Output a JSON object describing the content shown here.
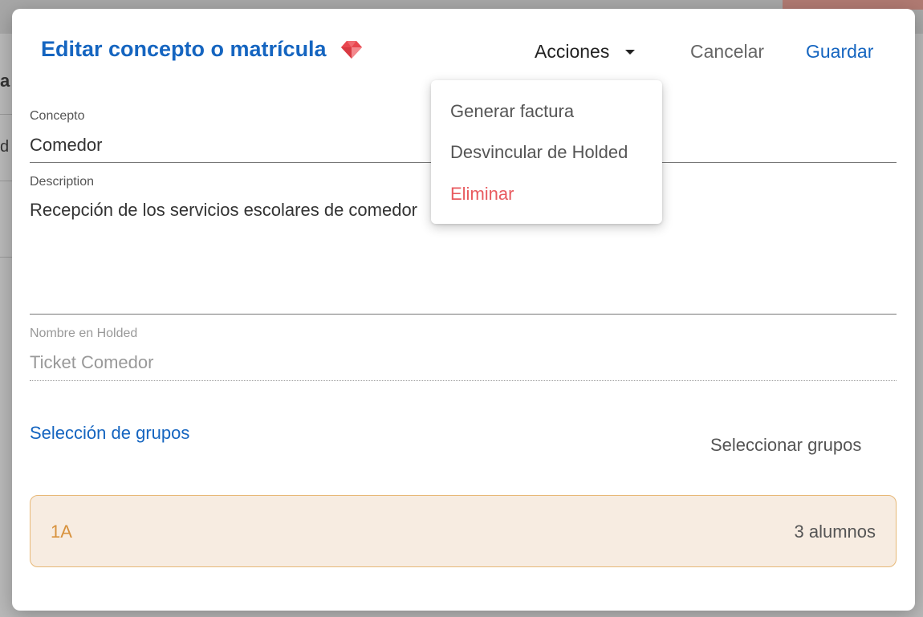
{
  "background": {
    "partial_heading": "a",
    "partial_text": "d"
  },
  "modal": {
    "title": "Editar concepto o matrícula",
    "title_icon": "gem-icon",
    "actions_label": "Acciones",
    "cancel_label": "Cancelar",
    "save_label": "Guardar"
  },
  "actions_menu": {
    "items": [
      {
        "label": "Generar factura",
        "variant": "default"
      },
      {
        "label": "Desvincular de Holded",
        "variant": "default"
      },
      {
        "label": "Eliminar",
        "variant": "danger"
      }
    ]
  },
  "form": {
    "concepto": {
      "label": "Concepto",
      "value": "Comedor"
    },
    "description": {
      "label": "Description",
      "value": "Recepción de los servicios escolares de comedor"
    },
    "holded_name": {
      "label": "Nombre en Holded",
      "value": "Ticket Comedor"
    }
  },
  "groups": {
    "section_title": "Selección de grupos",
    "select_label": "Seleccionar grupos",
    "items": [
      {
        "name": "1A",
        "count": "3 alumnos"
      }
    ]
  },
  "colors": {
    "primary": "#1565c0",
    "danger": "#e85a5f",
    "group_accent": "#d8923d",
    "group_bg": "#f7ece1"
  }
}
